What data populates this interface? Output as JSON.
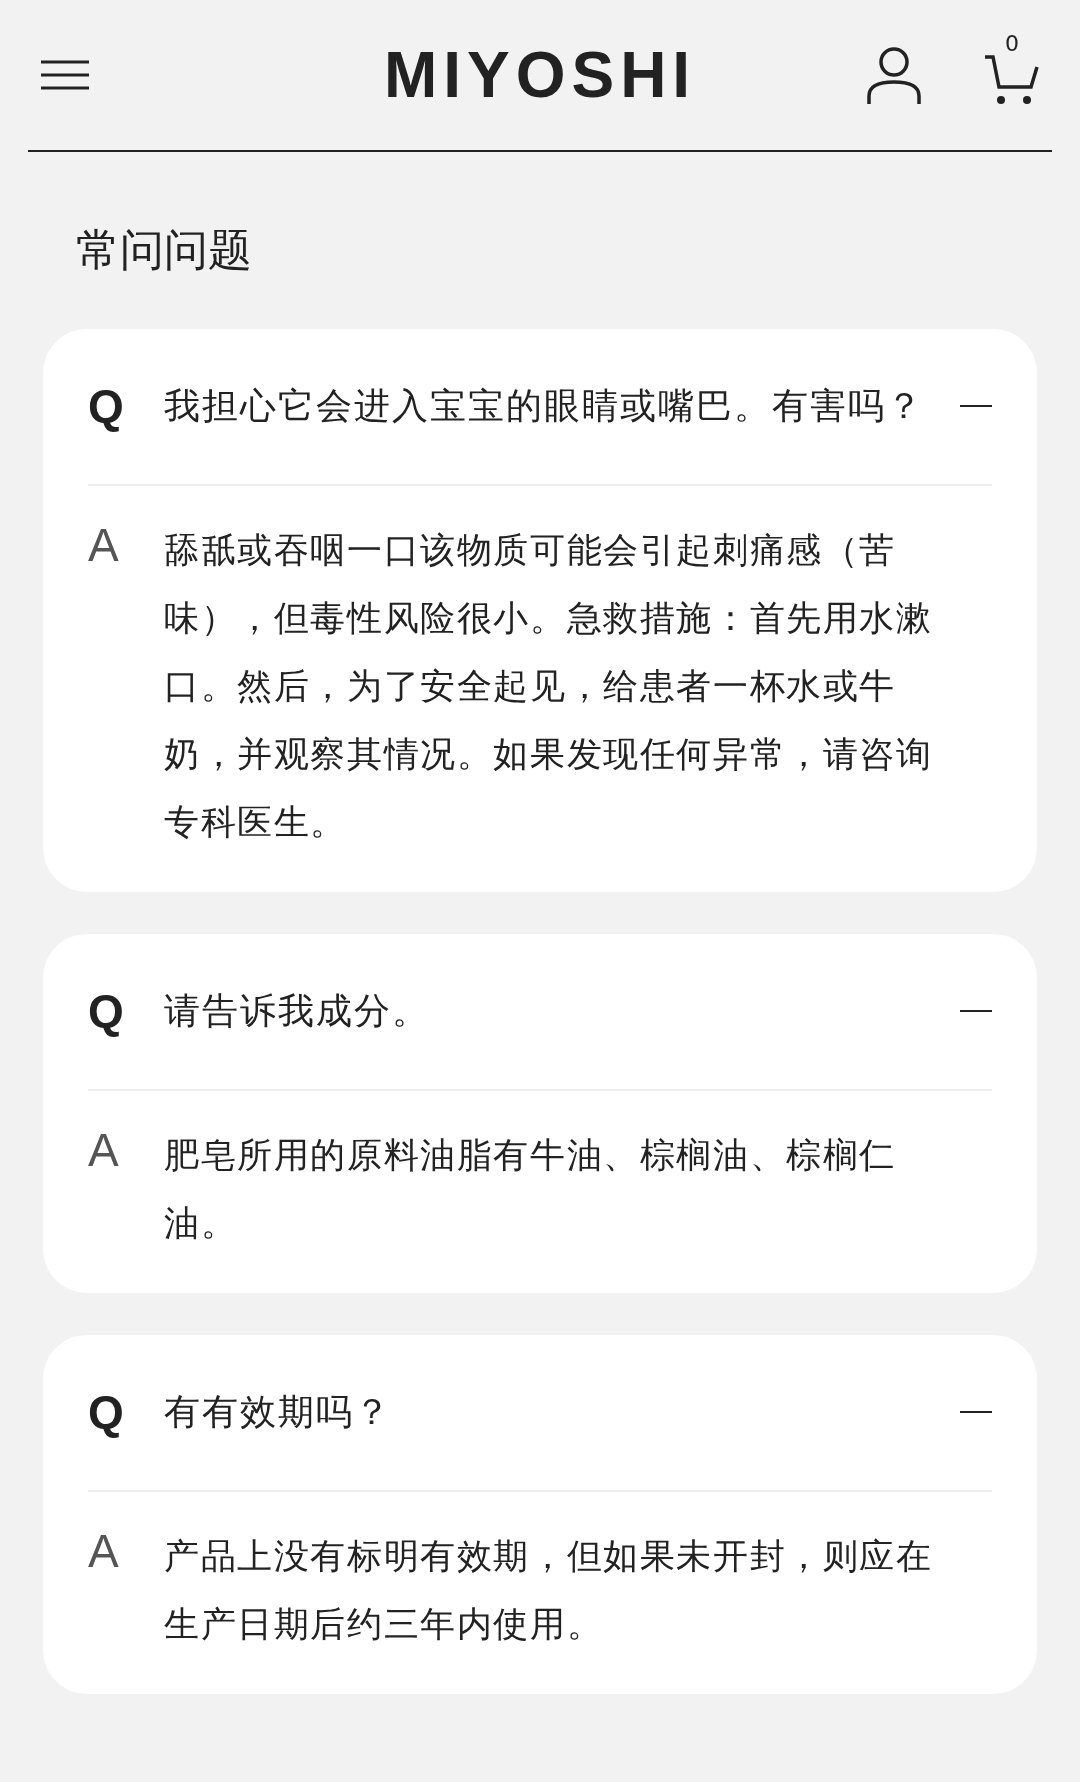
{
  "header": {
    "logo": "MIYOSHI",
    "cart_count": "0"
  },
  "title": "常问问题",
  "faqs": [
    {
      "q_mark": "Q",
      "question": "我担心它会进入宝宝的眼睛或嘴巴。有害吗？",
      "a_mark": "A",
      "answer": "舔舐或吞咽一口该物质可能会引起刺痛感（苦味），但毒性风险很小。急救措施：首先用水漱口。然后，为了安全起见，给患者一杯水或牛奶，并观察其情况。如果发现任何异常，请咨询专科医生。",
      "expanded": true
    },
    {
      "q_mark": "Q",
      "question": "请告诉我成分。",
      "a_mark": "A",
      "answer": "肥皂所用的原料油脂有牛油、棕榈油、棕榈仁油。",
      "expanded": true
    },
    {
      "q_mark": "Q",
      "question": "有有效期吗？",
      "a_mark": "A",
      "answer": "产品上没有标明有效期，但如果未开封，则应在生产日期后约三年内使用。",
      "expanded": true
    }
  ]
}
